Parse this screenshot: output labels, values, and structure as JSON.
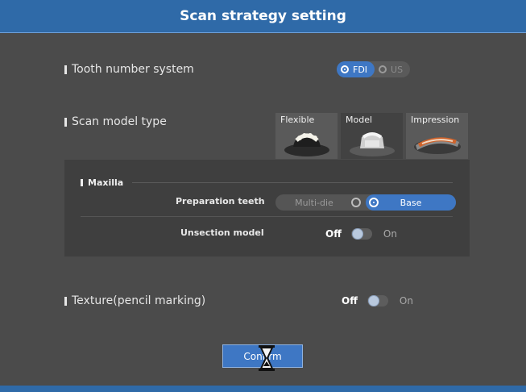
{
  "dialog": {
    "title": "Scan strategy setting"
  },
  "tooth_number": {
    "label": "Tooth number system",
    "options": [
      {
        "label": "FDI",
        "selected": true
      },
      {
        "label": "US",
        "selected": false
      }
    ]
  },
  "scan_model": {
    "label": "Scan model type",
    "cards": [
      {
        "label": "Flexible",
        "icon": "flexible-model-icon",
        "selected": false
      },
      {
        "label": "Model",
        "icon": "plaster-model-icon",
        "selected": true
      },
      {
        "label": "Impression",
        "icon": "impression-tray-icon",
        "selected": false
      }
    ]
  },
  "maxilla": {
    "label": "Maxilla",
    "preparation": {
      "label": "Preparation teeth",
      "options": [
        {
          "label": "Multi-die",
          "selected": false
        },
        {
          "label": "Base",
          "selected": true
        }
      ]
    },
    "unsection": {
      "label": "Unsection model",
      "off": "Off",
      "on": "On",
      "value": false
    }
  },
  "texture": {
    "label": "Texture(pencil marking)",
    "off": "Off",
    "on": "On",
    "value": false
  },
  "confirm": {
    "label": "Confirm"
  },
  "cursor": {
    "icon": "hourglass-busy-icon"
  },
  "colors": {
    "accent": "#3e77c4",
    "titlebar": "#2f6aa8",
    "background": "#4b4b4b",
    "panel": "#3f3f3f"
  }
}
